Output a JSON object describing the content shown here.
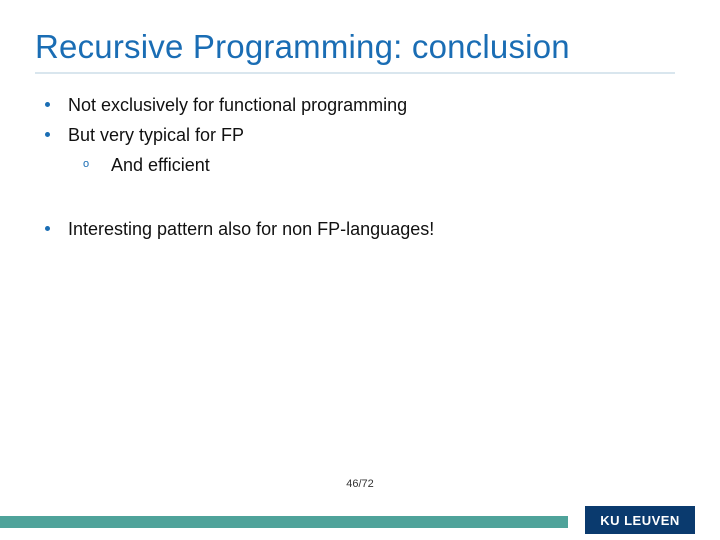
{
  "title": "Recursive Programming: conclusion",
  "bullets": {
    "b1": "Not exclusively for functional programming",
    "b2": "But very typical for FP",
    "b2_sub1": "And efficient",
    "b3": "Interesting pattern also for non FP-languages!"
  },
  "page": "46/72",
  "logo": "KU LEUVEN"
}
